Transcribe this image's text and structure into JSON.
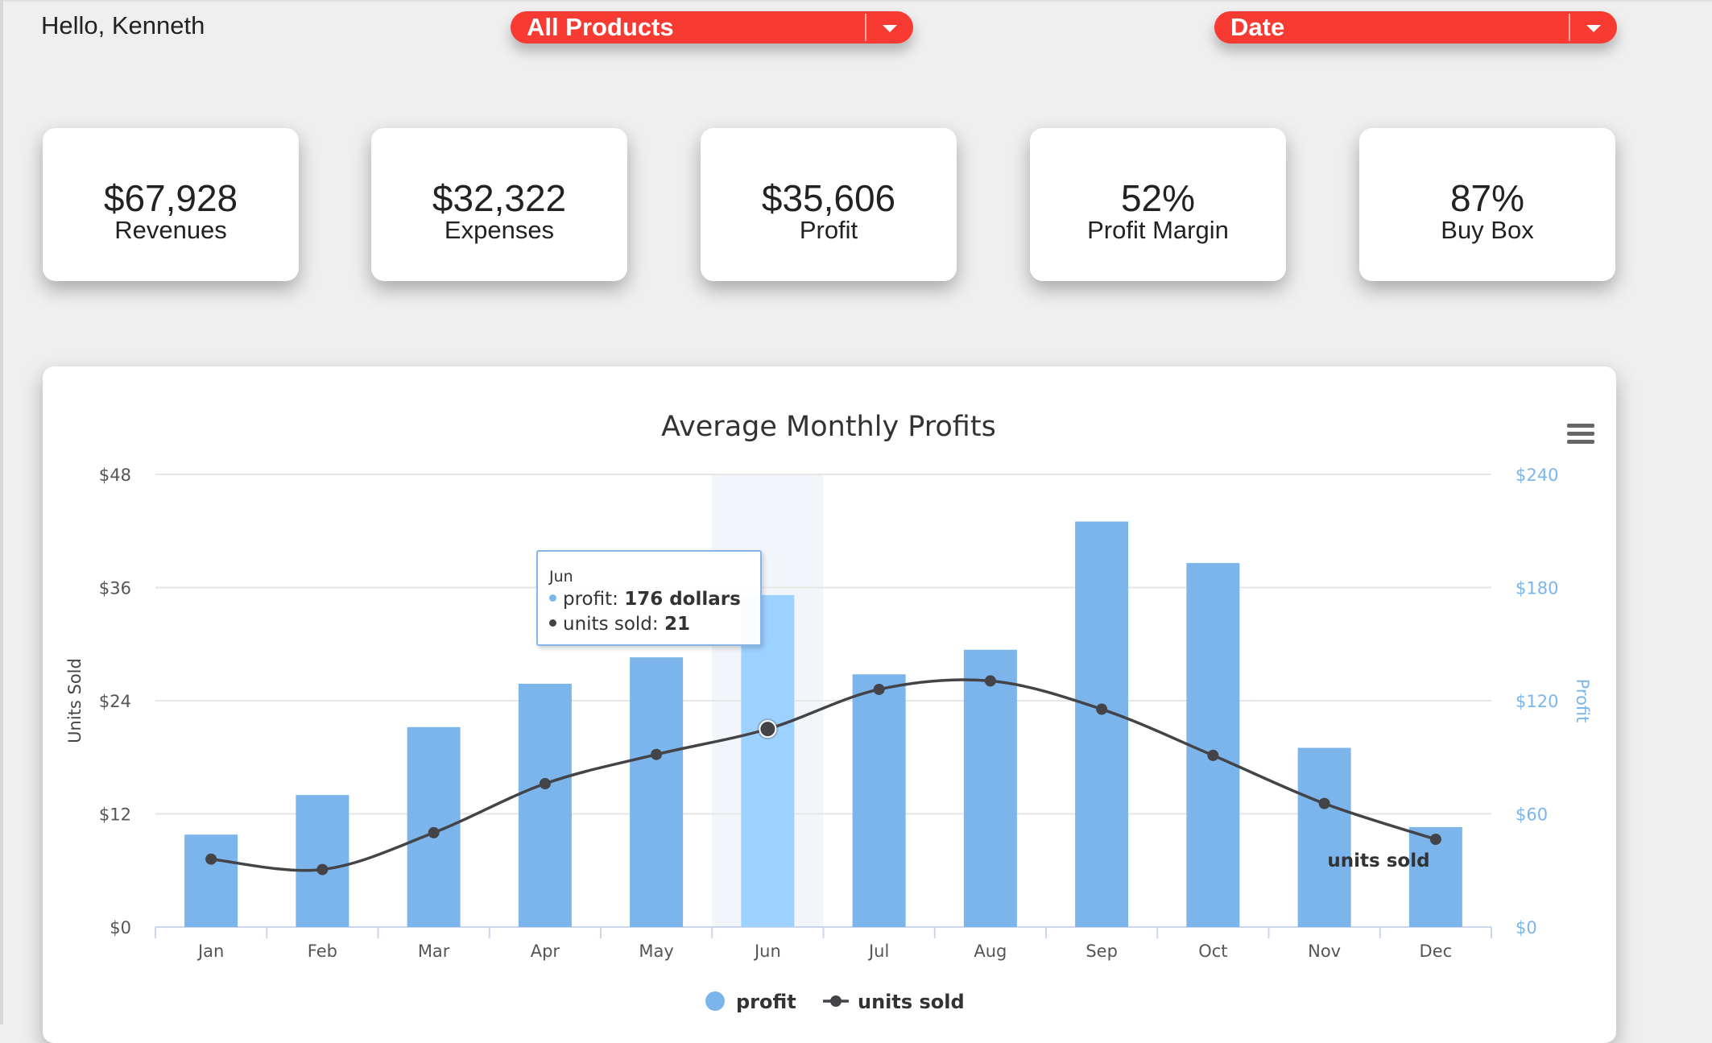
{
  "header": {
    "greeting": "Hello, Kenneth",
    "product_filter": {
      "selected": "All Products",
      "icon": "caret-down-icon"
    },
    "date_filter": {
      "selected": "Date",
      "icon": "caret-down-icon"
    },
    "accent_color": "#f73a32"
  },
  "kpis": [
    {
      "value": "$67,928",
      "label": "Revenues"
    },
    {
      "value": "$32,322",
      "label": "Expenses"
    },
    {
      "value": "$35,606",
      "label": "Profit"
    },
    {
      "value": "52%",
      "label": "Profit Margin"
    },
    {
      "value": "87%",
      "label": "Buy Box"
    }
  ],
  "chart": {
    "menu_icon": "hamburger-menu-icon",
    "tooltip": {
      "header": "Jun",
      "rows": [
        {
          "name": "profit",
          "sep": ": ",
          "value": "176 dollars",
          "color": "#7cb5ec"
        },
        {
          "name": "units sold",
          "sep": ": ",
          "value": "21",
          "color": "#434348"
        }
      ]
    }
  },
  "chart_data": {
    "type": "bar",
    "title": "Average Monthly Profits",
    "categories": [
      "Jan",
      "Feb",
      "Mar",
      "Apr",
      "May",
      "Jun",
      "Jul",
      "Aug",
      "Sep",
      "Oct",
      "Nov",
      "Dec"
    ],
    "highlighted_category": "Jun",
    "y_left": {
      "label": "Units Sold",
      "ticks": [
        "$0",
        "$12",
        "$24",
        "$36",
        "$48"
      ],
      "range": [
        0,
        48
      ]
    },
    "y_right": {
      "label": "Profit",
      "ticks": [
        "$0",
        "$60",
        "$120",
        "$180",
        "$240"
      ],
      "range": [
        0,
        240
      ],
      "color": "#7cb5ec"
    },
    "series": [
      {
        "name": "profit",
        "type": "column",
        "axis": "right",
        "color": "#7cb5ec",
        "values": [
          49,
          70,
          106,
          129,
          143,
          176,
          134,
          147,
          215,
          193,
          95,
          53
        ]
      },
      {
        "name": "units sold",
        "type": "spline",
        "axis": "left",
        "color": "#434348",
        "values": [
          7.2,
          6.1,
          10.0,
          15.2,
          18.3,
          21.0,
          25.2,
          26.1,
          23.1,
          18.2,
          13.1,
          9.3
        ]
      }
    ],
    "series_end_label": "units sold",
    "legend": {
      "position": "bottom-center",
      "items": [
        "profit",
        "units sold"
      ]
    },
    "grid": true
  }
}
